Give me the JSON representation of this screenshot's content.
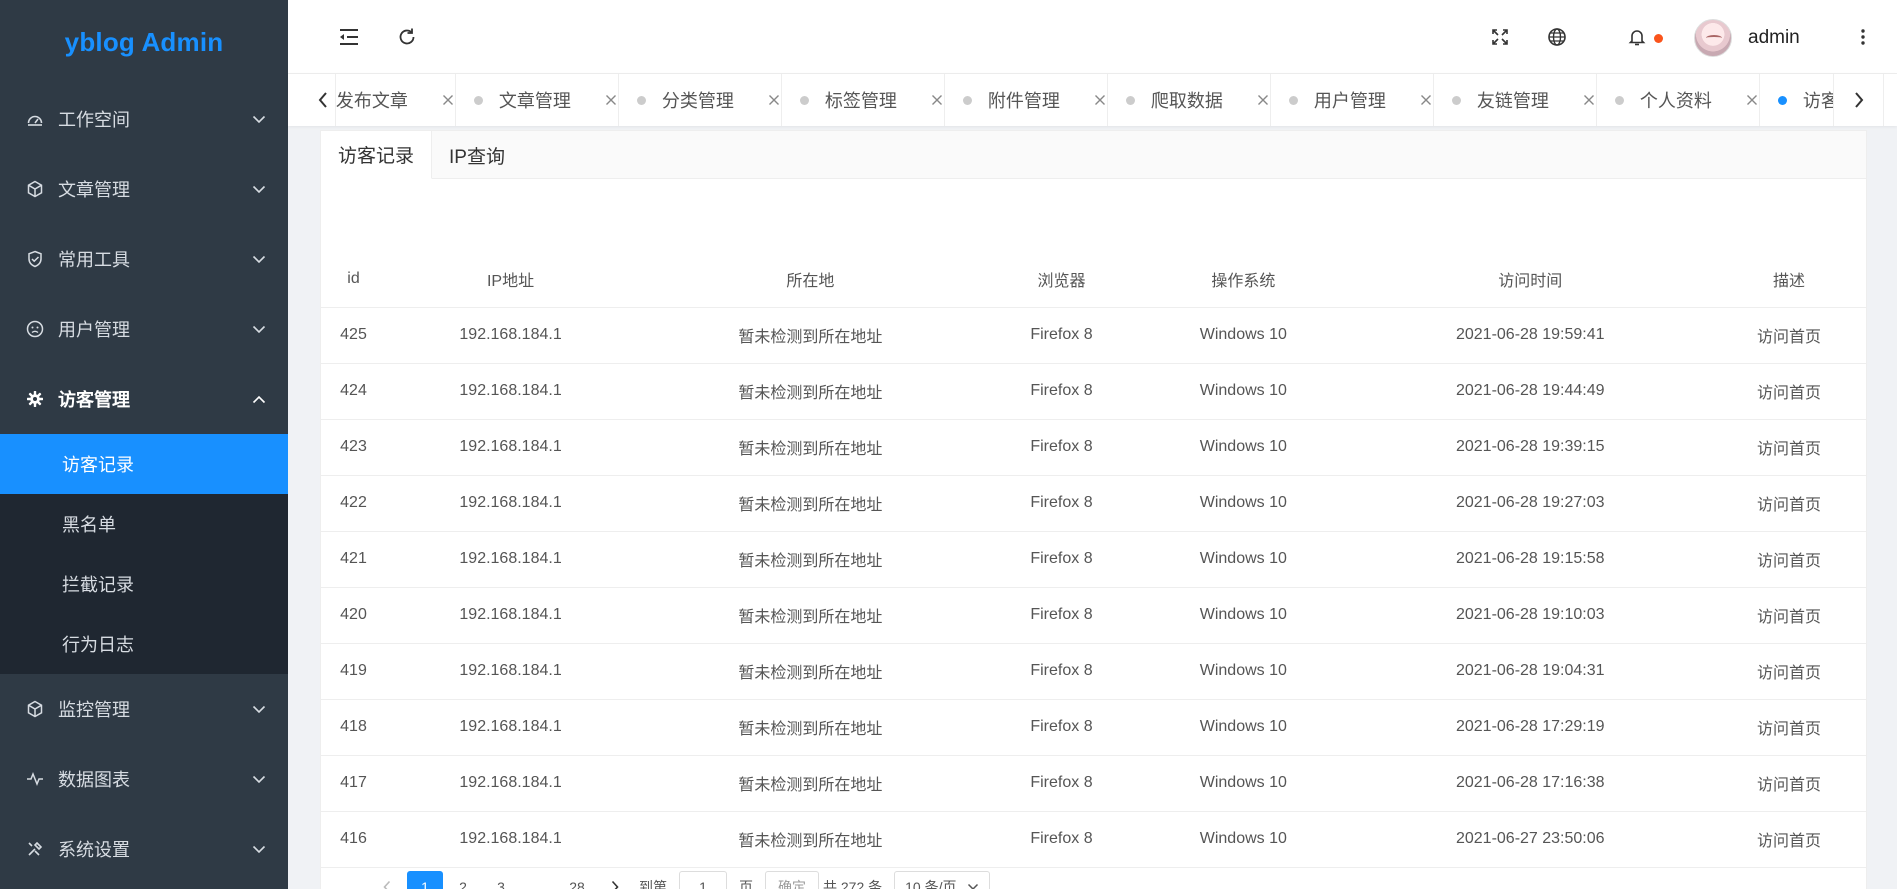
{
  "app": {
    "title": "yblog Admin"
  },
  "sidebar": {
    "items": [
      {
        "label": "工作空间",
        "icon": "dashboard-icon",
        "expanded": false
      },
      {
        "label": "文章管理",
        "icon": "cube-icon",
        "expanded": false
      },
      {
        "label": "常用工具",
        "icon": "shield-check-icon",
        "expanded": false
      },
      {
        "label": "用户管理",
        "icon": "face-icon",
        "expanded": false
      },
      {
        "label": "访客管理",
        "icon": "gear-icon",
        "expanded": true,
        "children": [
          {
            "label": "访客记录",
            "active": true
          },
          {
            "label": "黑名单",
            "active": false
          },
          {
            "label": "拦截记录",
            "active": false
          },
          {
            "label": "行为日志",
            "active": false
          }
        ]
      },
      {
        "label": "监控管理",
        "icon": "cube-icon",
        "expanded": false
      },
      {
        "label": "数据图表",
        "icon": "pulse-icon",
        "expanded": false
      },
      {
        "label": "系统设置",
        "icon": "tools-icon",
        "expanded": false
      }
    ]
  },
  "header": {
    "username": "admin",
    "notification_dot_color": "#fa541c"
  },
  "tags": [
    {
      "label": "发布文章",
      "active": false
    },
    {
      "label": "文章管理",
      "active": false
    },
    {
      "label": "分类管理",
      "active": false
    },
    {
      "label": "标签管理",
      "active": false
    },
    {
      "label": "附件管理",
      "active": false
    },
    {
      "label": "爬取数据",
      "active": false
    },
    {
      "label": "用户管理",
      "active": false
    },
    {
      "label": "友链管理",
      "active": false
    },
    {
      "label": "个人资料",
      "active": false
    },
    {
      "label": "访客记录",
      "active": true
    }
  ],
  "content": {
    "tabs": [
      {
        "label": "访客记录",
        "active": true
      },
      {
        "label": "IP查询",
        "active": false
      }
    ],
    "table": {
      "columns": [
        "id",
        "IP地址",
        "所在地",
        "浏览器",
        "操作系统",
        "访问时间",
        "描述"
      ],
      "rows": [
        [
          "425",
          "192.168.184.1",
          "暂未检测到所在地址",
          "Firefox 8",
          "Windows 10",
          "2021-06-28 19:59:41",
          "访问首页"
        ],
        [
          "424",
          "192.168.184.1",
          "暂未检测到所在地址",
          "Firefox 8",
          "Windows 10",
          "2021-06-28 19:44:49",
          "访问首页"
        ],
        [
          "423",
          "192.168.184.1",
          "暂未检测到所在地址",
          "Firefox 8",
          "Windows 10",
          "2021-06-28 19:39:15",
          "访问首页"
        ],
        [
          "422",
          "192.168.184.1",
          "暂未检测到所在地址",
          "Firefox 8",
          "Windows 10",
          "2021-06-28 19:27:03",
          "访问首页"
        ],
        [
          "421",
          "192.168.184.1",
          "暂未检测到所在地址",
          "Firefox 8",
          "Windows 10",
          "2021-06-28 19:15:58",
          "访问首页"
        ],
        [
          "420",
          "192.168.184.1",
          "暂未检测到所在地址",
          "Firefox 8",
          "Windows 10",
          "2021-06-28 19:10:03",
          "访问首页"
        ],
        [
          "419",
          "192.168.184.1",
          "暂未检测到所在地址",
          "Firefox 8",
          "Windows 10",
          "2021-06-28 19:04:31",
          "访问首页"
        ],
        [
          "418",
          "192.168.184.1",
          "暂未检测到所在地址",
          "Firefox 8",
          "Windows 10",
          "2021-06-28 17:29:19",
          "访问首页"
        ],
        [
          "417",
          "192.168.184.1",
          "暂未检测到所在地址",
          "Firefox 8",
          "Windows 10",
          "2021-06-28 17:16:38",
          "访问首页"
        ],
        [
          "416",
          "192.168.184.1",
          "暂未检测到所在地址",
          "Firefox 8",
          "Windows 10",
          "2021-06-27 23:50:06",
          "访问首页"
        ]
      ]
    },
    "pagination": {
      "pages": [
        "1",
        "2",
        "3",
        "...",
        "28"
      ],
      "current_page": "1",
      "goto_prefix": "到第",
      "goto_value": "1",
      "goto_suffix": "页",
      "confirm_label": "确定",
      "total_text": "共 272 条",
      "page_size_label": "10 条/页"
    }
  },
  "colors": {
    "primary": "#1890ff",
    "sidebar_bg": "#2f3a45",
    "submenu_bg": "#1f2731"
  }
}
